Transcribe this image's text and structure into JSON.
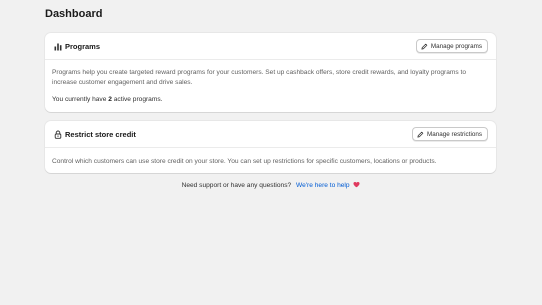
{
  "page": {
    "title": "Dashboard"
  },
  "programs_card": {
    "title": "Programs",
    "icon": "bar-chart-icon",
    "button_label": "Manage programs",
    "description": "Programs help you create targeted reward programs for your customers. Set up cashback offers, store credit rewards, and loyalty programs to increase customer engagement and drive sales.",
    "active_prefix": "You currently have",
    "active_count": "2",
    "active_suffix": "active programs."
  },
  "restrict_card": {
    "title": "Restrict store credit",
    "icon": "lock-icon",
    "button_label": "Manage restrictions",
    "description": "Control which customers can use store credit on your store. You can set up restrictions for specific customers, locations or products."
  },
  "footer": {
    "text": "Need support or have any questions?",
    "link_label": "We're here to help",
    "heart_color": "#e0395e",
    "link_color": "#005bd3"
  }
}
